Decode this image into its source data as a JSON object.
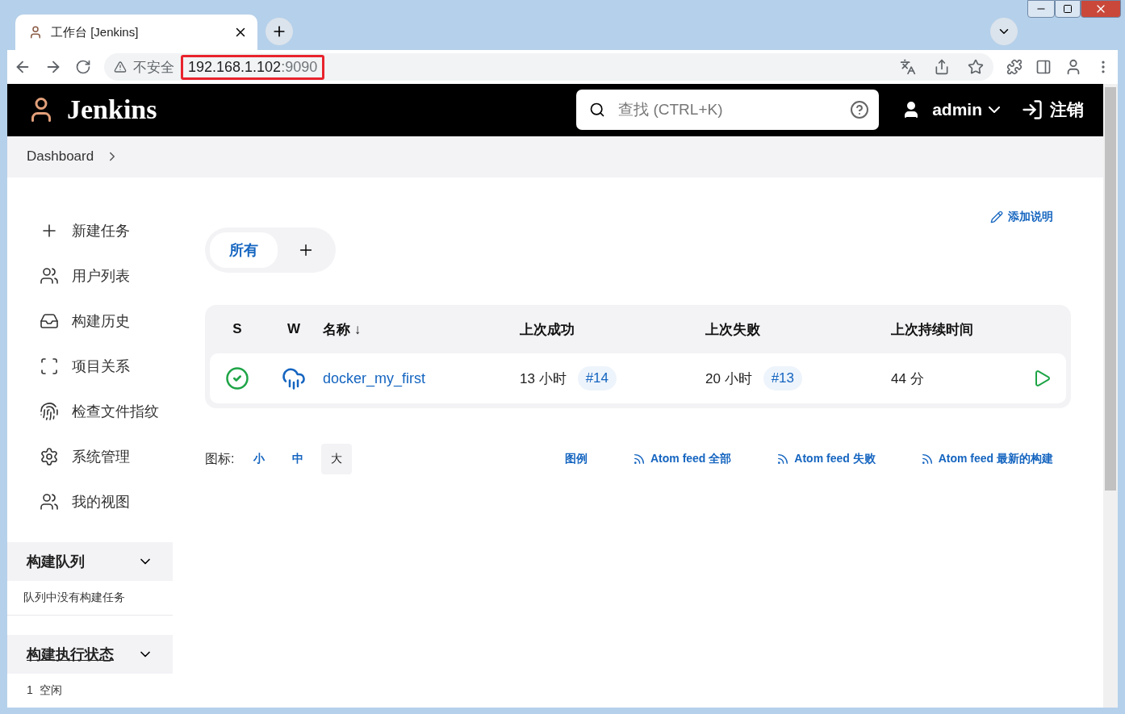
{
  "browser": {
    "tab_title": "工作台 [Jenkins]",
    "address": {
      "warning": "不安全",
      "host": "192.168.1.102",
      "port": ":9090",
      "highlighted": true
    }
  },
  "header": {
    "logo_text": "Jenkins",
    "search_placeholder": "查找 (CTRL+K)",
    "user": "admin",
    "logout": "注销"
  },
  "breadcrumb": [
    "Dashboard"
  ],
  "sidebar": {
    "items": [
      "新建任务",
      "用户列表",
      "构建历史",
      "项目关系",
      "检查文件指纹",
      "系统管理",
      "我的视图"
    ]
  },
  "build_queue": {
    "title": "构建队列",
    "expanded": true,
    "text": "队列中没有构建任务"
  },
  "executors": {
    "title": "构建执行状态",
    "expanded": true,
    "items": [
      {
        "number": "1",
        "status": "空闲"
      }
    ]
  },
  "add_description": "添加说明",
  "view_tabs": [
    {
      "label": "所有",
      "selected": true
    }
  ],
  "table": {
    "columns": [
      "S",
      "W",
      "名称 ↓",
      "上次成功",
      "上次失败",
      "上次持续时间"
    ],
    "rows": [
      {
        "succeeded": true,
        "name": "docker_my_first",
        "last_success": {
          "time": "13 小时",
          "build": "#14"
        },
        "last_failure": {
          "time": "20 小时",
          "build": "#13"
        },
        "duration": "44 分"
      }
    ]
  },
  "footer": {
    "icon_label": "图标:",
    "sizes": [
      {
        "label": "小",
        "selected": false
      },
      {
        "label": "中",
        "selected": false
      },
      {
        "label": "大",
        "selected": true
      }
    ],
    "links": [
      {
        "kind": "plain",
        "label": "图例"
      },
      {
        "kind": "feed",
        "label": "Atom feed 全部"
      },
      {
        "kind": "feed",
        "label": "Atom feed 失败"
      },
      {
        "kind": "feed",
        "label": "Atom feed 最新的构建"
      }
    ]
  }
}
